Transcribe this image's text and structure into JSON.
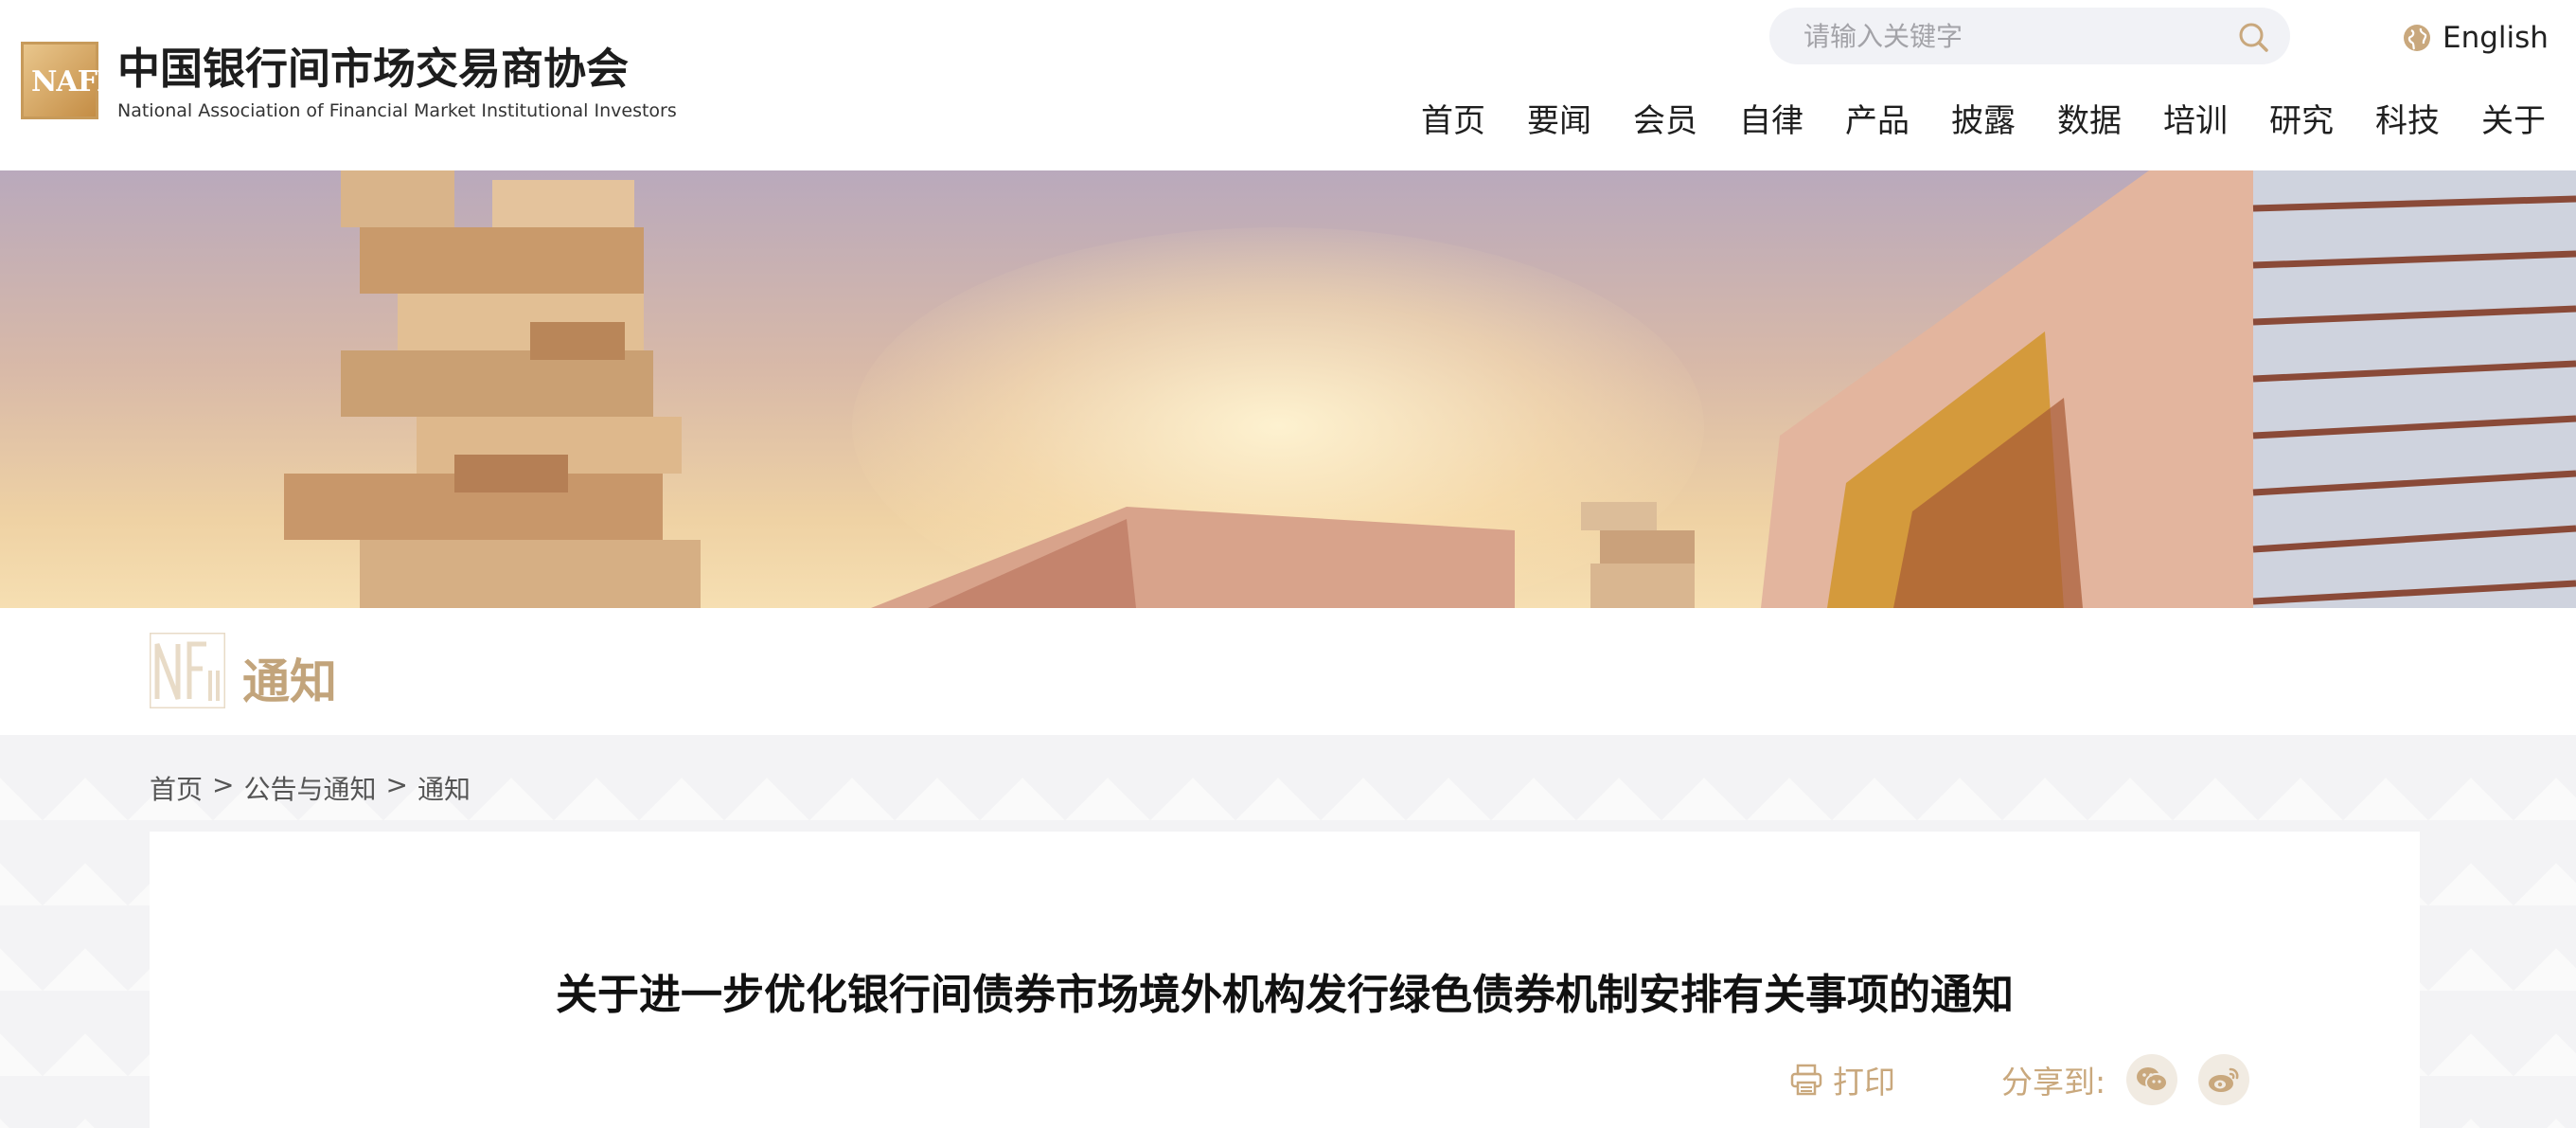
{
  "header": {
    "logo_text": "NAFMII",
    "org_name_cn": "中国银行间市场交易商协会",
    "org_name_en": "National Association of Financial Market Institutional Investors",
    "search_placeholder": "请输入关键字",
    "language_label": "English",
    "nav": [
      "首页",
      "要闻",
      "会员",
      "自律",
      "产品",
      "披露",
      "数据",
      "培训",
      "研究",
      "科技",
      "关于"
    ]
  },
  "section": {
    "title": "通知"
  },
  "breadcrumb": [
    "首页",
    "公告与通知",
    "通知"
  ],
  "breadcrumb_separator": ">",
  "article": {
    "title": "关于进一步优化银行间债券市场境外机构发行绿色债券机制安排有关事项的通知",
    "print_label": "打印",
    "share_label": "分享到:"
  },
  "colors": {
    "accent_gold": "#c9a87d",
    "logo_gold": "#c79a5a",
    "search_bg": "#f1f2f6"
  },
  "icons": [
    "search-icon",
    "globe-icon",
    "printer-icon",
    "wechat-icon",
    "weibo-icon"
  ]
}
